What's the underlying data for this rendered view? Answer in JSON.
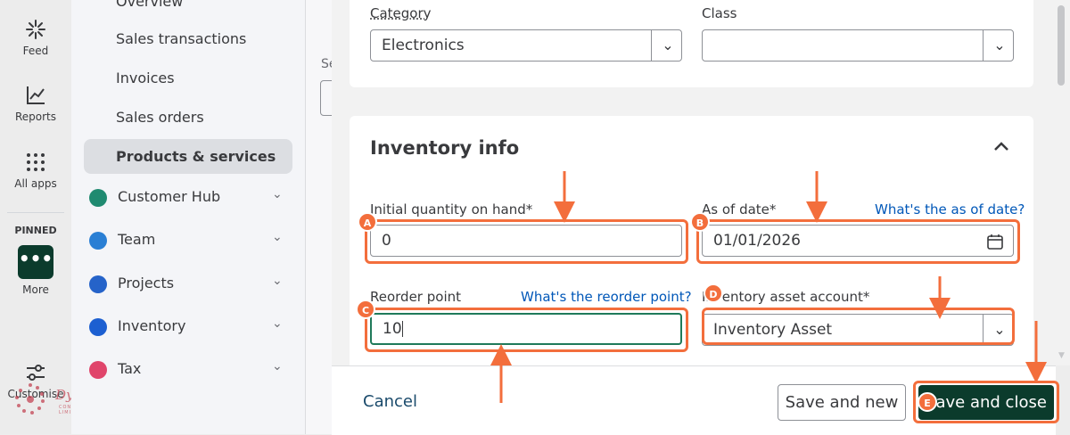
{
  "rail": {
    "items": [
      {
        "label": "Feed",
        "icon": "sparkle-icon"
      },
      {
        "label": "Reports",
        "icon": "line-chart-icon"
      },
      {
        "label": "All apps",
        "icon": "grid-icon"
      }
    ],
    "pinned_label": "PINNED",
    "more_label": "More",
    "more_icon": "•••",
    "customise_label": "Customise"
  },
  "nav": {
    "sub_items": [
      "Overview",
      "Sales transactions",
      "Invoices",
      "Sales orders",
      "Products & services"
    ],
    "active": "Products & services",
    "main_items": [
      {
        "label": "Customer Hub",
        "color": "#1f8a70"
      },
      {
        "label": "Team",
        "color": "#2a7fd4"
      },
      {
        "label": "Projects",
        "color": "#2563c9"
      },
      {
        "label": "Inventory",
        "color": "#1c5fd1"
      },
      {
        "label": "Tax",
        "color": "#e0456b"
      }
    ],
    "chevron": "⌄"
  },
  "behind": {
    "fragment": "Se"
  },
  "form": {
    "category_label": "Category",
    "category_value": "Electronics",
    "class_label": "Class",
    "class_value": "",
    "inventory_title": "Inventory info",
    "initial_qty_label": "Initial quantity on hand*",
    "initial_qty_value": "0",
    "as_of_label": "As of date*",
    "as_of_link": "What's the as of date?",
    "as_of_value": "01/01/2026",
    "reorder_label": "Reorder point",
    "reorder_link": "What's the reorder point?",
    "reorder_value": "10",
    "asset_label": "Inventory asset account*",
    "asset_value": "Inventory Asset"
  },
  "footer": {
    "cancel": "Cancel",
    "save_new": "Save and new",
    "save_close": "Save and close"
  },
  "annotations": {
    "badges": [
      "A",
      "B",
      "C",
      "D",
      "E"
    ],
    "color": "#f36e3c"
  },
  "watermark": {
    "brand": "Dynasty",
    "sub": "CONSULTING LIMITED"
  }
}
